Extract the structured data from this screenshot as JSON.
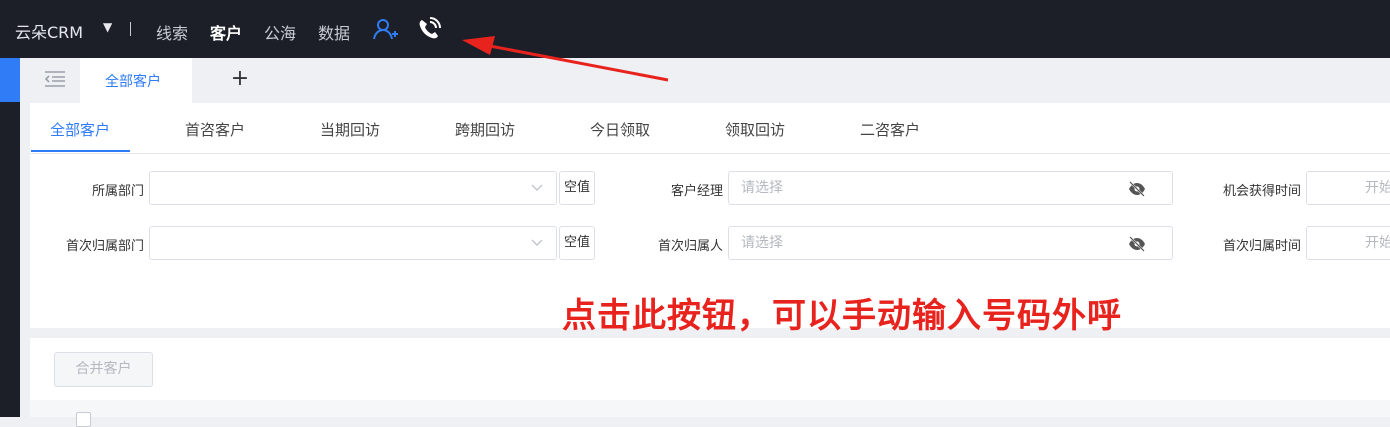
{
  "topbar": {
    "brand": "云朵CRM",
    "nav": [
      "线索",
      "客户",
      "公海",
      "数据"
    ],
    "active_nav": "客户",
    "icons": [
      "add-user-icon",
      "phone-call-icon"
    ],
    "colors": {
      "background": "#1c1f28",
      "accent": "#2f7cf6"
    }
  },
  "tabs": {
    "open_tab": "全部客户",
    "add_symbol": "+"
  },
  "subtabs": [
    "全部客户",
    "首咨客户",
    "当期回访",
    "跨期回访",
    "今日领取",
    "领取回访",
    "二咨客户"
  ],
  "filters": {
    "dept_label": "所属部门",
    "first_dept_label": "首次归属部门",
    "null_label": "空值",
    "manager_label": "客户经理",
    "first_owner_label": "首次归属人",
    "placeholder": "请选择",
    "chance_time_label": "机会获得时间",
    "first_owner_time_label": "首次归属时间",
    "date_placeholder": "开始"
  },
  "annotation": {
    "text": "点击此按钮，可以手动输入号码外呼",
    "color": "#e8231e"
  },
  "list": {
    "merge_button": "合并客户"
  }
}
